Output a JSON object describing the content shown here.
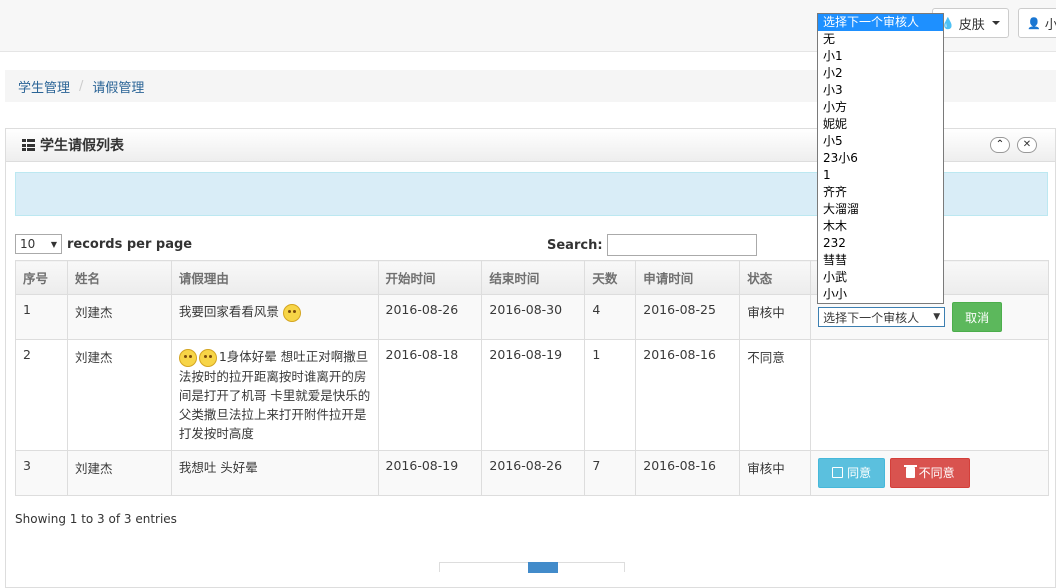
{
  "navbar": {
    "skin_label": "皮肤",
    "user_label": "小"
  },
  "breadcrumb": {
    "items": [
      "学生管理",
      "请假管理"
    ],
    "separator": "/"
  },
  "widget": {
    "title": "学生请假列表"
  },
  "datatable": {
    "page_length": "10",
    "length_label": "records per page",
    "search_label": "Search:",
    "search_value": "",
    "columns": [
      "序号",
      "姓名",
      "请假理由",
      "开始时间",
      "结束时间",
      "天数",
      "申请时间",
      "状态",
      ""
    ],
    "rows": [
      {
        "id": "1",
        "name": "刘建杰",
        "reason": "我要回家看看风景",
        "emoji_count": 1,
        "emoji_position": "after",
        "start": "2016-08-26",
        "end": "2016-08-30",
        "days": "4",
        "applied": "2016-08-25",
        "status": "审核中"
      },
      {
        "id": "2",
        "name": "刘建杰",
        "reason": "1身体好晕  想吐正对啊撒旦法按时的拉开距离按时谁离开的房间是打开了机哥 卡里就爱是快乐的父类撒旦法拉上来打开附件拉开是打发按时高度",
        "emoji_count": 2,
        "emoji_position": "before",
        "start": "2016-08-18",
        "end": "2016-08-19",
        "days": "1",
        "applied": "2016-08-16",
        "status": "不同意"
      },
      {
        "id": "3",
        "name": "刘建杰",
        "reason": "我想吐 头好晕",
        "emoji_count": 0,
        "emoji_position": "none",
        "start": "2016-08-19",
        "end": "2016-08-26",
        "days": "7",
        "applied": "2016-08-16",
        "status": "审核中"
      }
    ],
    "row1_select_value": "选择下一个审核人",
    "cancel_label": "取消",
    "approve_label": "同意",
    "reject_label": "不同意",
    "info": "Showing 1 to 3 of 3 entries"
  },
  "reviewer_dropdown": {
    "options": [
      "选择下一个审核人",
      "无",
      "小1",
      "小2",
      "小3",
      "小方",
      "妮妮",
      "小5",
      "23小6",
      "1",
      "齐齐",
      "大溜溜",
      "木木",
      "232",
      "彗彗",
      "小武",
      "小小"
    ],
    "selected_index": 0
  },
  "colors": {
    "link": "#2a6496",
    "success": "#5cb85c",
    "info": "#5bc0de",
    "danger": "#d9534f",
    "alert_bg": "#d9edf7",
    "dropdown_highlight": "#1e90ff"
  }
}
